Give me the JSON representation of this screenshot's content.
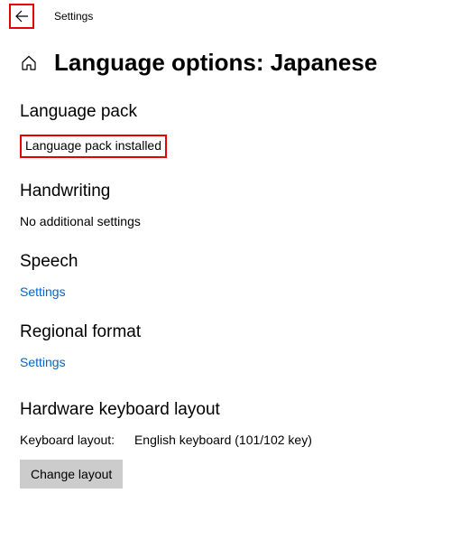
{
  "header": {
    "app_title": "Settings"
  },
  "page": {
    "title": "Language options: Japanese"
  },
  "sections": {
    "language_pack": {
      "heading": "Language pack",
      "status": "Language pack installed"
    },
    "handwriting": {
      "heading": "Handwriting",
      "status": "No additional settings"
    },
    "speech": {
      "heading": "Speech",
      "link": "Settings"
    },
    "regional_format": {
      "heading": "Regional format",
      "link": "Settings"
    },
    "hardware_keyboard": {
      "heading": "Hardware keyboard layout",
      "label": "Keyboard layout:",
      "value": "English keyboard (101/102 key)",
      "button": "Change layout"
    }
  }
}
